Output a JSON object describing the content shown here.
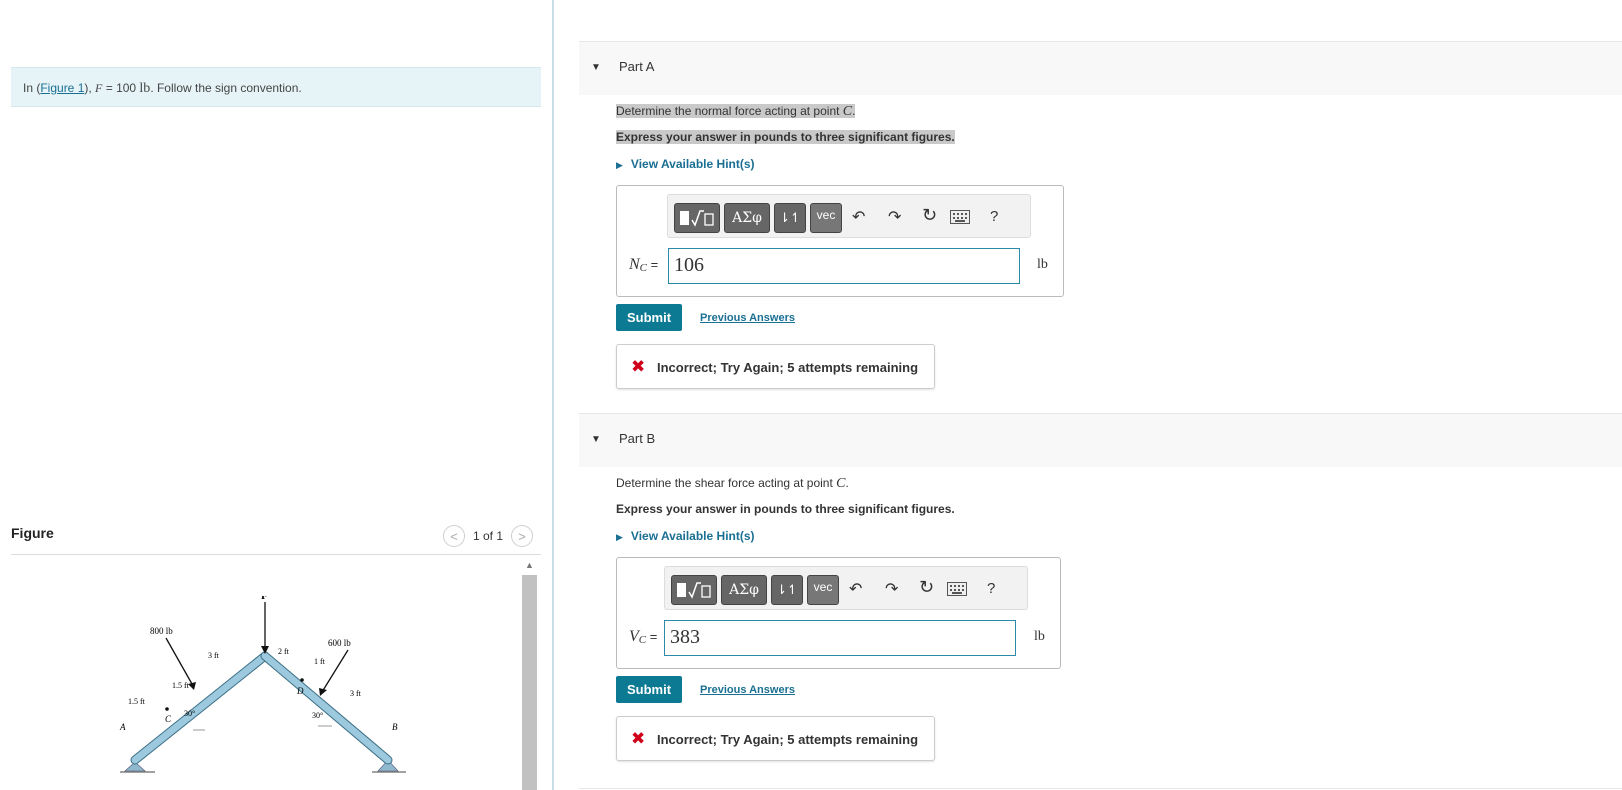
{
  "intro": {
    "prefix": "In (",
    "link": "Figure 1",
    "mid": "), ",
    "var_F": "F",
    "eq": " = 100 ",
    "unit": "lb",
    "suffix": ". Follow the sign convention."
  },
  "figure": {
    "title": "Figure",
    "nav_prev": "<",
    "page": "1 of 1",
    "nav_next": ">",
    "labels": {
      "force_F": "F",
      "load_800": "800 lb",
      "load_600": "600 lb",
      "dim_3ft_left": "3 ft",
      "dim_2ft": "2 ft",
      "dim_1ft": "1 ft",
      "dim_15ft_upper": "1.5 ft",
      "dim_15ft_lower": "1.5 ft",
      "dim_3ft_right": "3 ft",
      "angle_left": "30°",
      "angle_right": "30°",
      "point_A": "A",
      "point_B": "B",
      "point_C": "C",
      "point_D": "D"
    }
  },
  "partA": {
    "title": "Part A",
    "question": "Determine the normal force acting at point ",
    "question_point": "C",
    "question_end": ".",
    "instruction": "Express your answer in pounds to three significant figures.",
    "hint": "View Available Hint(s)",
    "var_main": "N",
    "var_sub": "C",
    "equals": " =",
    "answer_value": "106",
    "unit": "lb",
    "submit": "Submit",
    "previous": "Previous Answers",
    "feedback": "Incorrect; Try Again; 5 attempts remaining"
  },
  "partB": {
    "title": "Part B",
    "question": "Determine the shear force acting at point ",
    "question_point": "C",
    "question_end": ".",
    "instruction": "Express your answer in pounds to three significant figures.",
    "hint": "View Available Hint(s)",
    "var_main": "V",
    "var_sub": "C",
    "equals": " =",
    "answer_value": "383",
    "unit": "lb",
    "submit": "Submit",
    "previous": "Previous Answers",
    "feedback": "Incorrect; Try Again; 5 attempts remaining"
  },
  "toolbar": {
    "templates_icon": "template-icon",
    "greek": "ΑΣφ",
    "arrows": "⇂↿",
    "vec": "vec",
    "undo_icon": "undo-icon",
    "redo_icon": "redo-icon",
    "reset_icon": "reset-icon",
    "keyboard_icon": "keyboard-icon",
    "help": "?"
  }
}
